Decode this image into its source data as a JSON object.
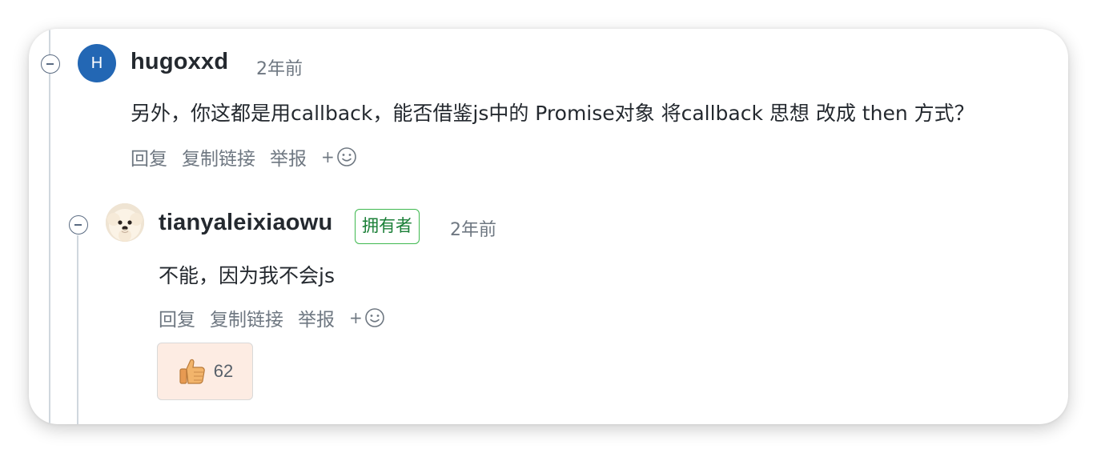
{
  "comments": [
    {
      "avatar_letter": "H",
      "avatar_color": "#2367b4",
      "username": "hugoxxd",
      "time": "2年前",
      "body": "另外，你这都是用callback，能否借鉴js中的 Promise对象 将callback 思想 改成 then 方式？",
      "actions": {
        "reply": "回复",
        "copy_link": "复制链接",
        "report": "举报",
        "add_reaction": "+"
      }
    },
    {
      "avatar_description": "dog-photo-avatar",
      "username": "tianyaleixiaowu",
      "badge": "拥有者",
      "time": "2年前",
      "body": "不能，因为我不会js",
      "actions": {
        "reply": "回复",
        "copy_link": "复制链接",
        "report": "举报",
        "add_reaction": "+"
      },
      "reaction": {
        "icon": "thumbs-up-icon",
        "count": "62"
      }
    }
  ],
  "colors": {
    "accent_avatar": "#2367b4",
    "owner_badge_border": "#3fb950",
    "owner_badge_text": "#1a7f37",
    "reaction_bg": "#fdece3"
  }
}
